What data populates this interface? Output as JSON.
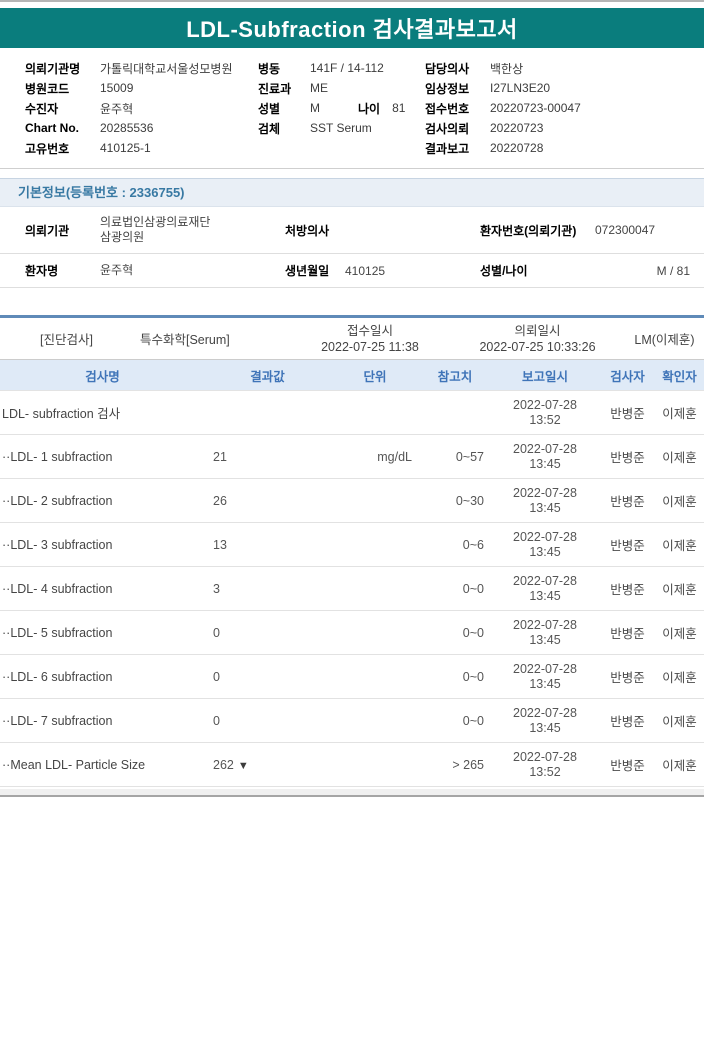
{
  "title": "LDL-Subfraction 검사결과보고서",
  "patient_header": {
    "left": [
      {
        "label": "의뢰기관명",
        "value": "가톨릭대학교서울성모병원"
      },
      {
        "label": "병원코드",
        "value": "15009"
      },
      {
        "label": "수진자",
        "value": "윤주혁"
      },
      {
        "label": "Chart No.",
        "value": "20285536"
      },
      {
        "label": "고유번호",
        "value": "410125-1"
      }
    ],
    "middle": [
      {
        "label": "병동",
        "value": "141F / 14-112"
      },
      {
        "label": "진료과",
        "value": "ME"
      },
      {
        "label": "성별",
        "value": "M",
        "label2": "나이",
        "value2": "81"
      },
      {
        "label": "검체",
        "value": "SST Serum"
      }
    ],
    "right": [
      {
        "label": "담당의사",
        "value": "백한상"
      },
      {
        "label": "임상정보",
        "value": "I27LN3E20"
      },
      {
        "label": "접수번호",
        "value": "20220723-00047"
      },
      {
        "label": "검사의뢰",
        "value": "20220723"
      },
      {
        "label": "결과보고",
        "value": "20220728"
      }
    ]
  },
  "basic_info": {
    "section_title": "기본정보(등록번호 : 2336755)",
    "request_org_label": "의뢰기관",
    "request_org_line1": "의료법인삼광의료재단",
    "request_org_line2": "삼광의원",
    "physician_label": "처방의사",
    "physician_value": "",
    "patient_no_label": "환자번호(의뢰기관)",
    "patient_no_value": "072300047",
    "patient_name_label": "환자명",
    "patient_name_value": "윤주혁",
    "birth_label": "생년월일",
    "birth_value": "410125",
    "sex_age_label": "성별/나이",
    "sex_age_value": "M / 81"
  },
  "exam_section": {
    "category": "[진단검사]",
    "test_group": "특수화학[Serum]",
    "receipt_label": "접수일시",
    "receipt_value": "2022-07-25  11:38",
    "request_label": "의뢰일시",
    "request_value": "2022-07-25  10:33:26",
    "reporter": "LM(이제훈)"
  },
  "results": {
    "columns": [
      "검사명",
      "결과값",
      "단위",
      "참고치",
      "보고일시",
      "검사자",
      "확인자"
    ],
    "rows": [
      {
        "name": "LDL- subfraction 검사",
        "result": "",
        "flag": "",
        "unit": "",
        "ref": "",
        "date": "2022-07-28",
        "time": "13:52",
        "tester": "반병준",
        "verifier": "이제훈"
      },
      {
        "name": "··LDL- 1 subfraction",
        "result": "21",
        "flag": "",
        "unit": "mg/dL",
        "ref": "0~57",
        "date": "2022-07-28",
        "time": "13:45",
        "tester": "반병준",
        "verifier": "이제훈"
      },
      {
        "name": "··LDL- 2 subfraction",
        "result": "26",
        "flag": "",
        "unit": "",
        "ref": "0~30",
        "date": "2022-07-28",
        "time": "13:45",
        "tester": "반병준",
        "verifier": "이제훈"
      },
      {
        "name": "··LDL- 3 subfraction",
        "result": "13",
        "flag": "",
        "unit": "",
        "ref": "0~6",
        "date": "2022-07-28",
        "time": "13:45",
        "tester": "반병준",
        "verifier": "이제훈"
      },
      {
        "name": "··LDL- 4 subfraction",
        "result": "3",
        "flag": "",
        "unit": "",
        "ref": "0~0",
        "date": "2022-07-28",
        "time": "13:45",
        "tester": "반병준",
        "verifier": "이제훈"
      },
      {
        "name": "··LDL- 5 subfraction",
        "result": "0",
        "flag": "",
        "unit": "",
        "ref": "0~0",
        "date": "2022-07-28",
        "time": "13:45",
        "tester": "반병준",
        "verifier": "이제훈"
      },
      {
        "name": "··LDL- 6 subfraction",
        "result": "0",
        "flag": "",
        "unit": "",
        "ref": "0~0",
        "date": "2022-07-28",
        "time": "13:45",
        "tester": "반병준",
        "verifier": "이제훈"
      },
      {
        "name": "··LDL- 7 subfraction",
        "result": "0",
        "flag": "",
        "unit": "",
        "ref": "0~0",
        "date": "2022-07-28",
        "time": "13:45",
        "tester": "반병준",
        "verifier": "이제훈"
      },
      {
        "name": "··Mean LDL- Particle Size",
        "result": "262",
        "flag": "▼",
        "unit": "",
        "ref": "> 265",
        "date": "2022-07-28",
        "time": "13:52",
        "tester": "반병준",
        "verifier": "이제훈"
      }
    ]
  }
}
